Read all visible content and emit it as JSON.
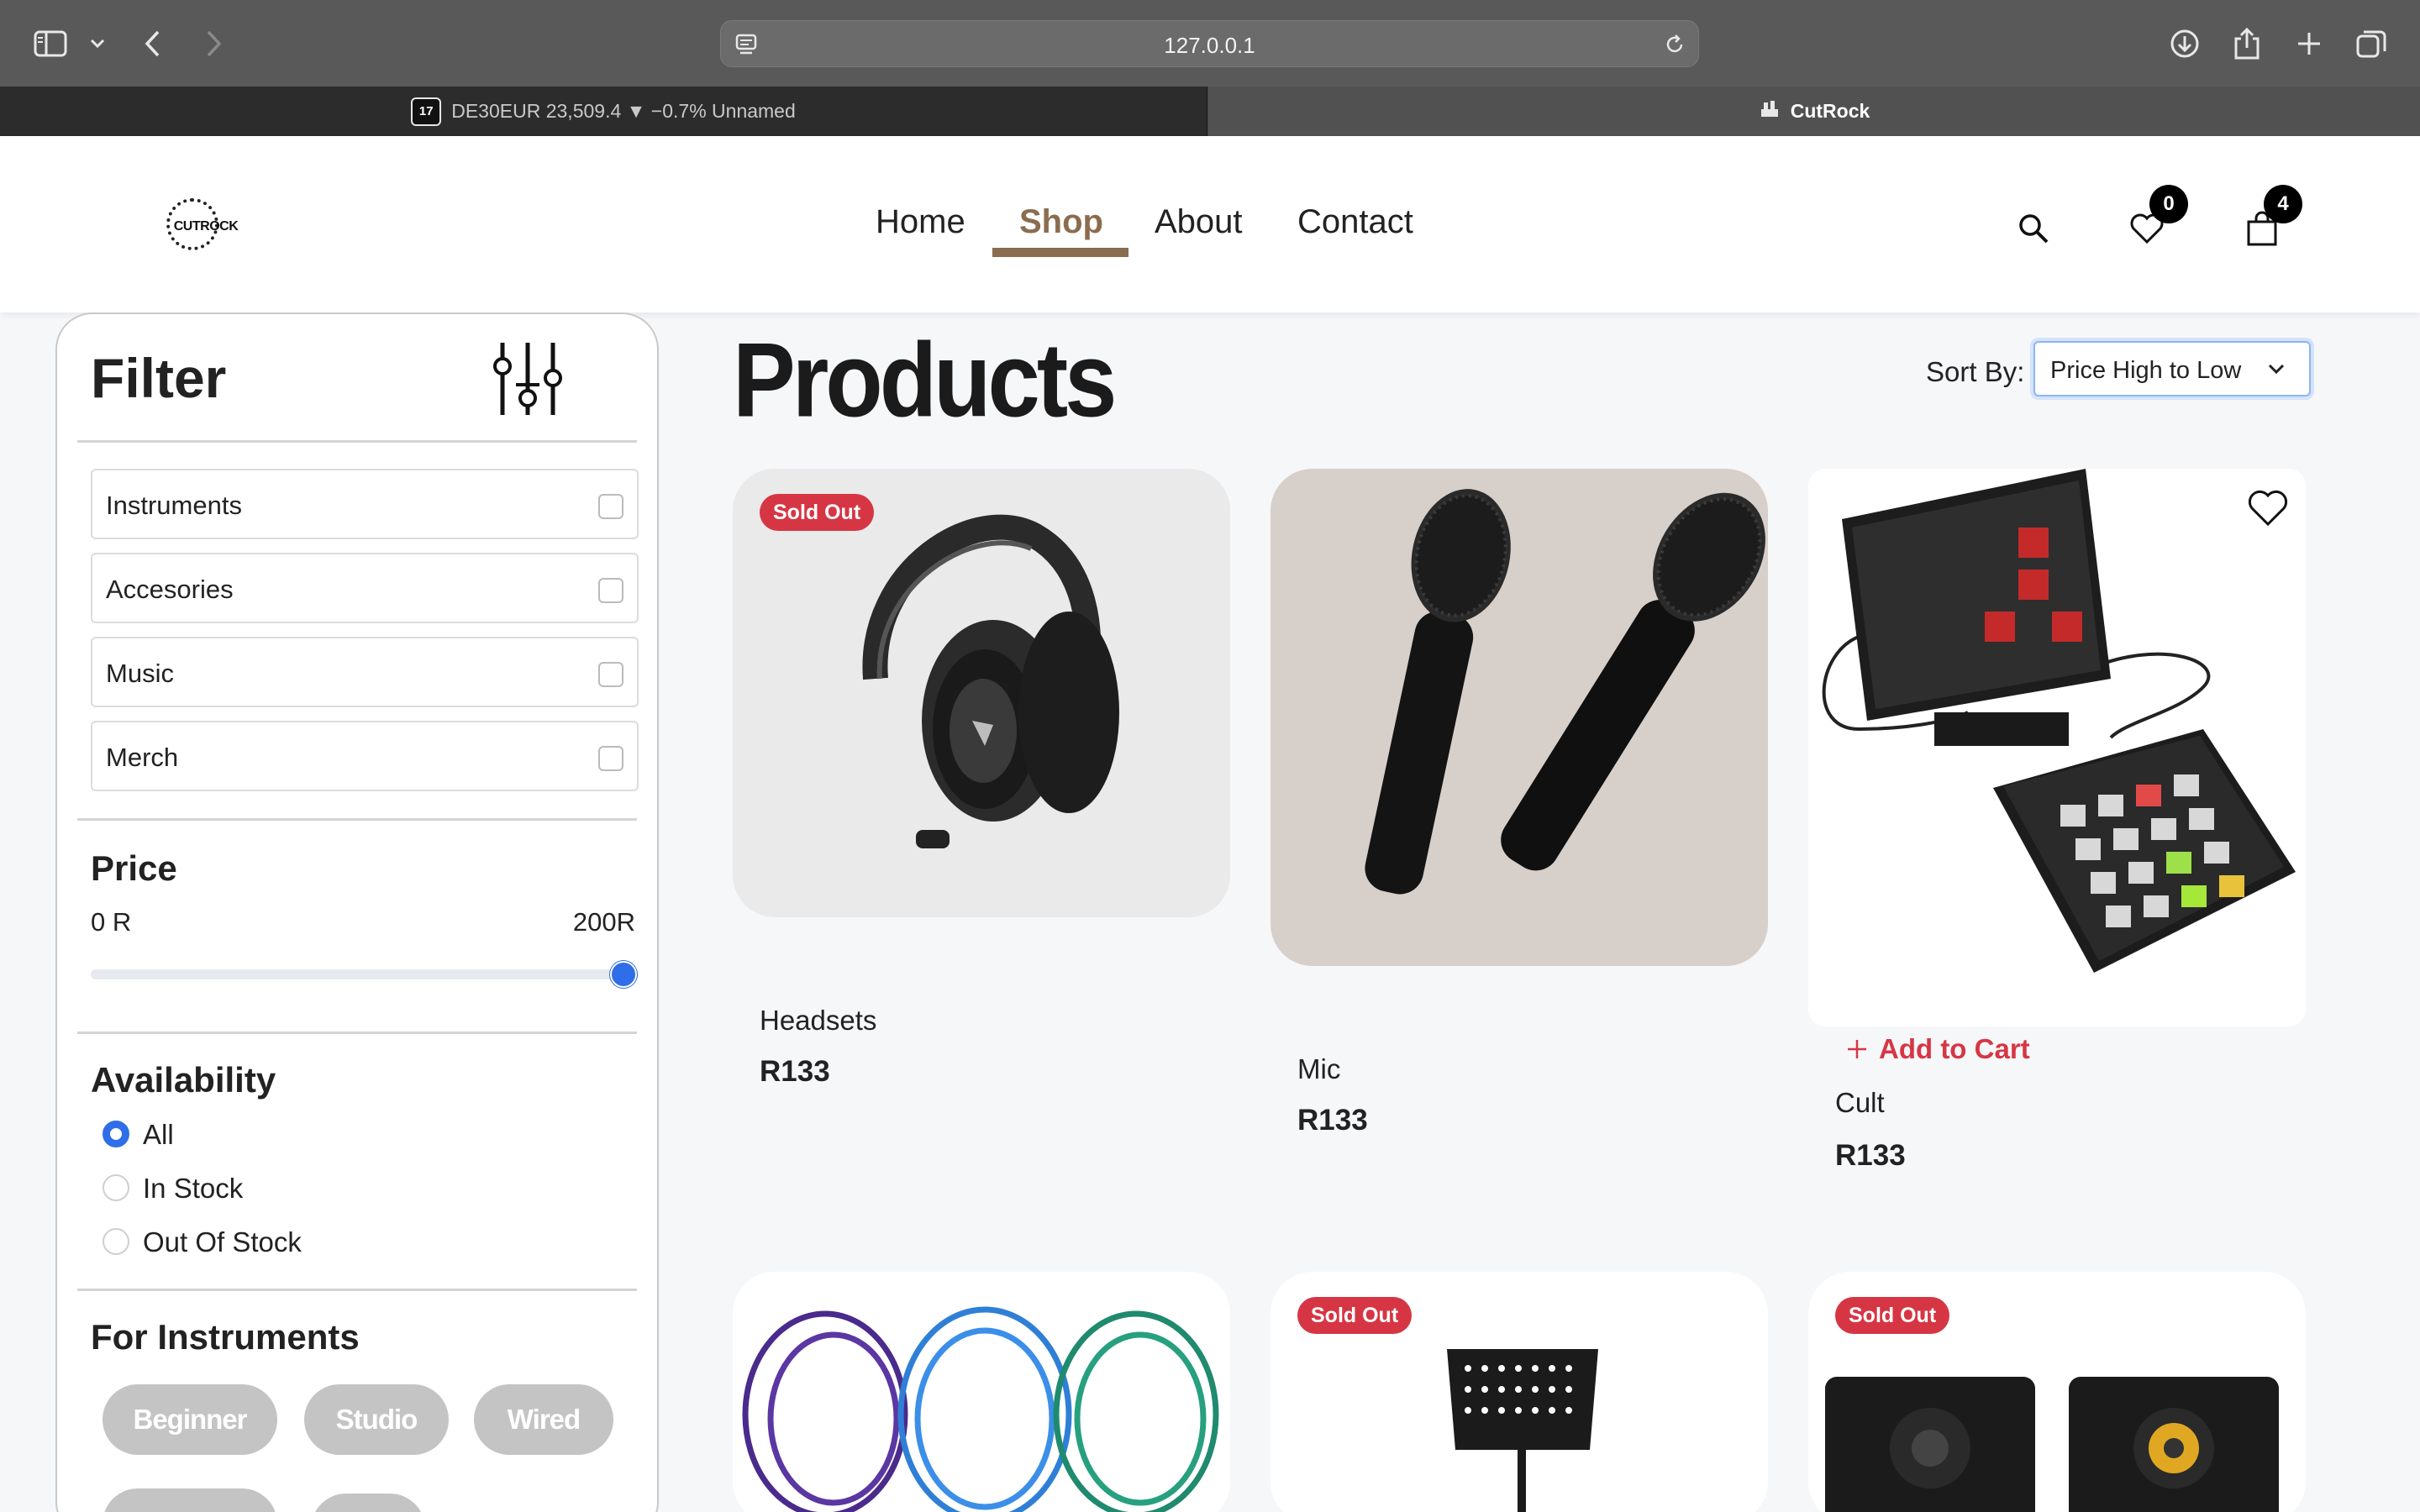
{
  "browser": {
    "url": "127.0.0.1",
    "tabs": [
      {
        "label": "DE30EUR 23,509.4 ▼ −0.7% Unnamed",
        "badge": "17"
      },
      {
        "label": "CutRock"
      }
    ]
  },
  "site": {
    "logo_text": "CUTROCK",
    "nav": [
      "Home",
      "Shop",
      "About",
      "Contact"
    ],
    "wishlist_count": "0",
    "cart_count": "4"
  },
  "filter": {
    "title": "Filter",
    "categories": [
      "Instruments",
      "Accesories",
      "Music",
      "Merch"
    ],
    "price": {
      "title": "Price",
      "min_label": "0 R",
      "max_label": "200R",
      "slider_fraction": 1.0
    },
    "availability": {
      "title": "Availability",
      "options": [
        "All",
        "In Stock",
        "Out Of Stock"
      ],
      "selected": "All"
    },
    "instruments": {
      "title": "For Instruments",
      "tags": [
        "Beginner",
        "Studio",
        "Wired"
      ]
    }
  },
  "products": {
    "title": "Products",
    "sort_label": "Sort By:",
    "sort_value": "Price High to Low",
    "sold_out_label": "Sold Out",
    "add_to_cart_label": "Add to Cart",
    "items": [
      {
        "name": "Headsets",
        "price": "R133",
        "sold_out": true
      },
      {
        "name": "Mic",
        "price": "R133",
        "sold_out": false
      },
      {
        "name": "Cult",
        "price": "R133",
        "sold_out": false
      },
      {
        "name": "",
        "price": "",
        "sold_out": false
      },
      {
        "name": "",
        "price": "",
        "sold_out": true
      },
      {
        "name": "",
        "price": "",
        "sold_out": true
      }
    ]
  },
  "colors": {
    "accent": "#8a6d4f",
    "sold_out": "#d63644",
    "range": "#2f6ee8"
  }
}
